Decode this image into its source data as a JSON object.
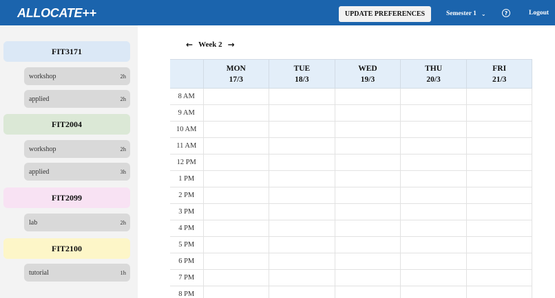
{
  "header": {
    "brand": "ALLOCATE++",
    "update_button": "UPDATE PREFERENCES",
    "semester": "Semester 1",
    "help_icon": "help-circle-icon",
    "logout": "Logout"
  },
  "colors": {
    "topbar": "#1b64ad",
    "sidebar_bg": "#f3f3f3",
    "class_pill": "#d9d9d9",
    "grid_header": "#e3eef9"
  },
  "sidebar": {
    "units": [
      {
        "code": "FIT3171",
        "color": "#dbe8f6",
        "classes": [
          {
            "name": "workshop",
            "duration": "2h"
          },
          {
            "name": "applied",
            "duration": "2h"
          }
        ]
      },
      {
        "code": "FIT2004",
        "color": "#dbe8d6",
        "classes": [
          {
            "name": "workshop",
            "duration": "2h"
          },
          {
            "name": "applied",
            "duration": "3h"
          }
        ]
      },
      {
        "code": "FIT2099",
        "color": "#f8e2f3",
        "classes": [
          {
            "name": "lab",
            "duration": "2h"
          }
        ]
      },
      {
        "code": "FIT2100",
        "color": "#fdf6c8",
        "classes": [
          {
            "name": "tutorial",
            "duration": "1h"
          }
        ]
      }
    ]
  },
  "week": {
    "label": "Week 2",
    "prev_icon": "arrow-left-icon",
    "next_icon": "arrow-right-icon"
  },
  "timetable": {
    "days": [
      {
        "day": "MON",
        "date": "17/3"
      },
      {
        "day": "TUE",
        "date": "18/3"
      },
      {
        "day": "WED",
        "date": "19/3"
      },
      {
        "day": "THU",
        "date": "20/3"
      },
      {
        "day": "FRI",
        "date": "21/3"
      }
    ],
    "times": [
      "8 AM",
      "9 AM",
      "10 AM",
      "11 AM",
      "12 PM",
      "1 PM",
      "2 PM",
      "3 PM",
      "4 PM",
      "5 PM",
      "6 PM",
      "7 PM",
      "8 PM"
    ]
  }
}
